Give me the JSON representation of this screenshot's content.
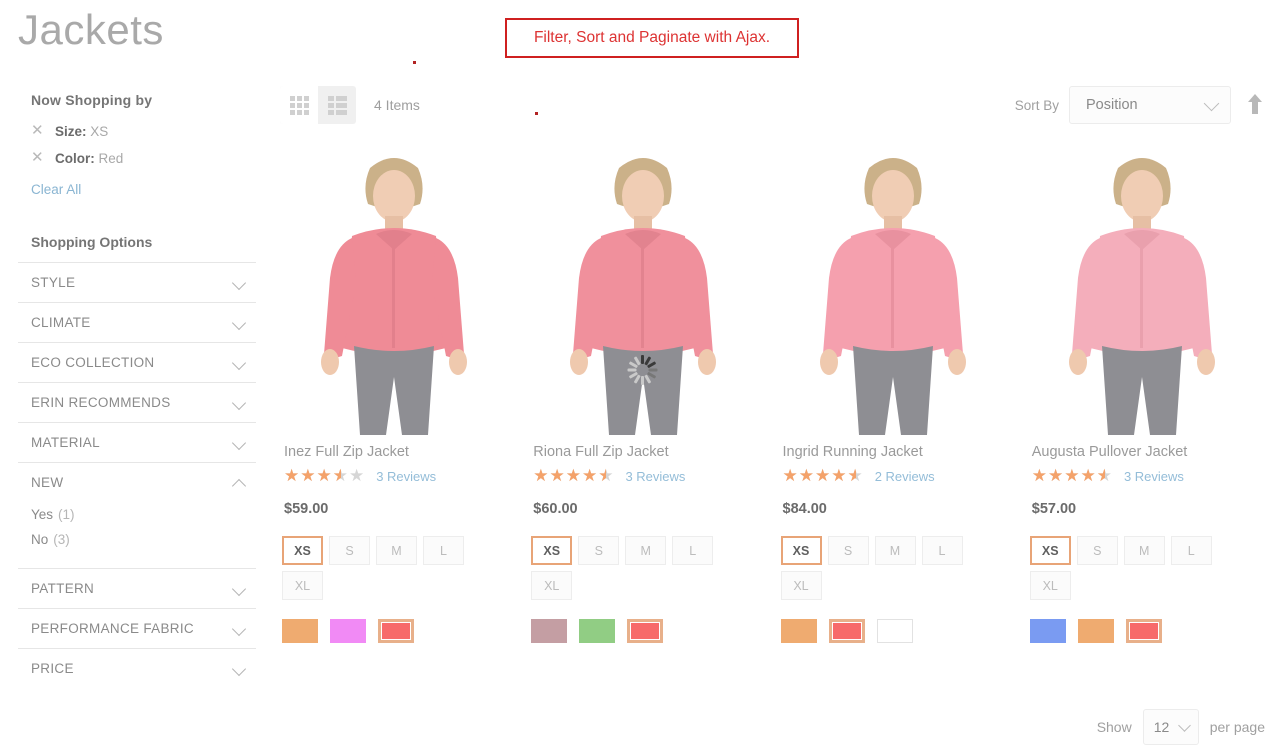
{
  "page": {
    "title": "Jackets"
  },
  "annotation": {
    "banner_text": "Filter, Sort and Paginate with Ajax."
  },
  "sidebar": {
    "now_shopping_title": "Now Shopping by",
    "active_filters": [
      {
        "label": "Size:",
        "value": "XS",
        "remove_icon": "close-icon"
      },
      {
        "label": "Color:",
        "value": "Red",
        "remove_icon": "close-icon"
      }
    ],
    "clear_all": "Clear All",
    "shopping_options_title": "Shopping Options",
    "filters": [
      {
        "title": "STYLE",
        "expanded": false,
        "icon": "chevron-down-icon"
      },
      {
        "title": "CLIMATE",
        "expanded": false,
        "icon": "chevron-down-icon"
      },
      {
        "title": "ECO COLLECTION",
        "expanded": false,
        "icon": "chevron-down-icon"
      },
      {
        "title": "ERIN RECOMMENDS",
        "expanded": false,
        "icon": "chevron-down-icon"
      },
      {
        "title": "MATERIAL",
        "expanded": false,
        "icon": "chevron-down-icon"
      },
      {
        "title": "NEW",
        "expanded": true,
        "icon": "chevron-up-icon",
        "options": [
          {
            "label": "Yes",
            "count": "(1)"
          },
          {
            "label": "No",
            "count": "(3)"
          }
        ]
      },
      {
        "title": "PATTERN",
        "expanded": false,
        "icon": "chevron-down-icon"
      },
      {
        "title": "PERFORMANCE FABRIC",
        "expanded": false,
        "icon": "chevron-down-icon"
      },
      {
        "title": "PRICE",
        "expanded": false,
        "icon": "chevron-down-icon"
      }
    ]
  },
  "toolbar": {
    "grid_mode_icon": "grid-view-icon",
    "list_mode_icon": "list-view-icon",
    "active_mode": "grid",
    "item_count": "4 Items",
    "sort_label": "Sort By",
    "sort_value": "Position",
    "sort_direction_icon": "arrow-up-icon",
    "sort_chevron_icon": "chevron-down-icon"
  },
  "products": [
    {
      "name": "Inez Full Zip Jacket",
      "rating_percent": 70,
      "reviews": "3 Reviews",
      "price": "$59.00",
      "sizes": [
        {
          "label": "XS",
          "selected": true
        },
        {
          "label": "S",
          "selected": false
        },
        {
          "label": "M",
          "selected": false
        },
        {
          "label": "L",
          "selected": false
        },
        {
          "label": "XL",
          "selected": false
        }
      ],
      "colors": [
        {
          "name": "orange",
          "hex": "#efab70",
          "selected": false
        },
        {
          "name": "purple",
          "hex": "#f18af5",
          "selected": false
        },
        {
          "name": "red",
          "hex": "#f76a6a",
          "selected": true
        }
      ]
    },
    {
      "name": "Riona Full Zip Jacket",
      "rating_percent": 90,
      "reviews": "3 Reviews",
      "price": "$60.00",
      "sizes": [
        {
          "label": "XS",
          "selected": true
        },
        {
          "label": "S",
          "selected": false
        },
        {
          "label": "M",
          "selected": false
        },
        {
          "label": "L",
          "selected": false
        },
        {
          "label": "XL",
          "selected": false
        }
      ],
      "colors": [
        {
          "name": "mauve",
          "hex": "#c49ea3",
          "selected": false
        },
        {
          "name": "green",
          "hex": "#91cd84",
          "selected": false
        },
        {
          "name": "red",
          "hex": "#f76a6a",
          "selected": true
        }
      ]
    },
    {
      "name": "Ingrid Running Jacket",
      "rating_percent": 90,
      "reviews": "2 Reviews",
      "price": "$84.00",
      "sizes": [
        {
          "label": "XS",
          "selected": true
        },
        {
          "label": "S",
          "selected": false
        },
        {
          "label": "M",
          "selected": false
        },
        {
          "label": "L",
          "selected": false
        },
        {
          "label": "XL",
          "selected": false
        }
      ],
      "colors": [
        {
          "name": "orange",
          "hex": "#efab70",
          "selected": false
        },
        {
          "name": "red",
          "hex": "#f76a6a",
          "selected": true
        },
        {
          "name": "white",
          "hex": "#ffffff",
          "selected": false
        }
      ]
    },
    {
      "name": "Augusta Pullover Jacket",
      "rating_percent": 90,
      "reviews": "3 Reviews",
      "price": "$57.00",
      "sizes": [
        {
          "label": "XS",
          "selected": true
        },
        {
          "label": "S",
          "selected": false
        },
        {
          "label": "M",
          "selected": false
        },
        {
          "label": "L",
          "selected": false
        },
        {
          "label": "XL",
          "selected": false
        }
      ],
      "colors": [
        {
          "name": "blue",
          "hex": "#7a9bf2",
          "selected": false
        },
        {
          "name": "orange",
          "hex": "#efab70",
          "selected": false
        },
        {
          "name": "red",
          "hex": "#f76a6a",
          "selected": true
        }
      ]
    }
  ],
  "footer": {
    "show_label": "Show",
    "per_page_value": "12",
    "per_page_label": "per page",
    "chevron_icon": "chevron-down-icon"
  },
  "loading": {
    "spinner_icon": "loading-spinner-icon"
  }
}
